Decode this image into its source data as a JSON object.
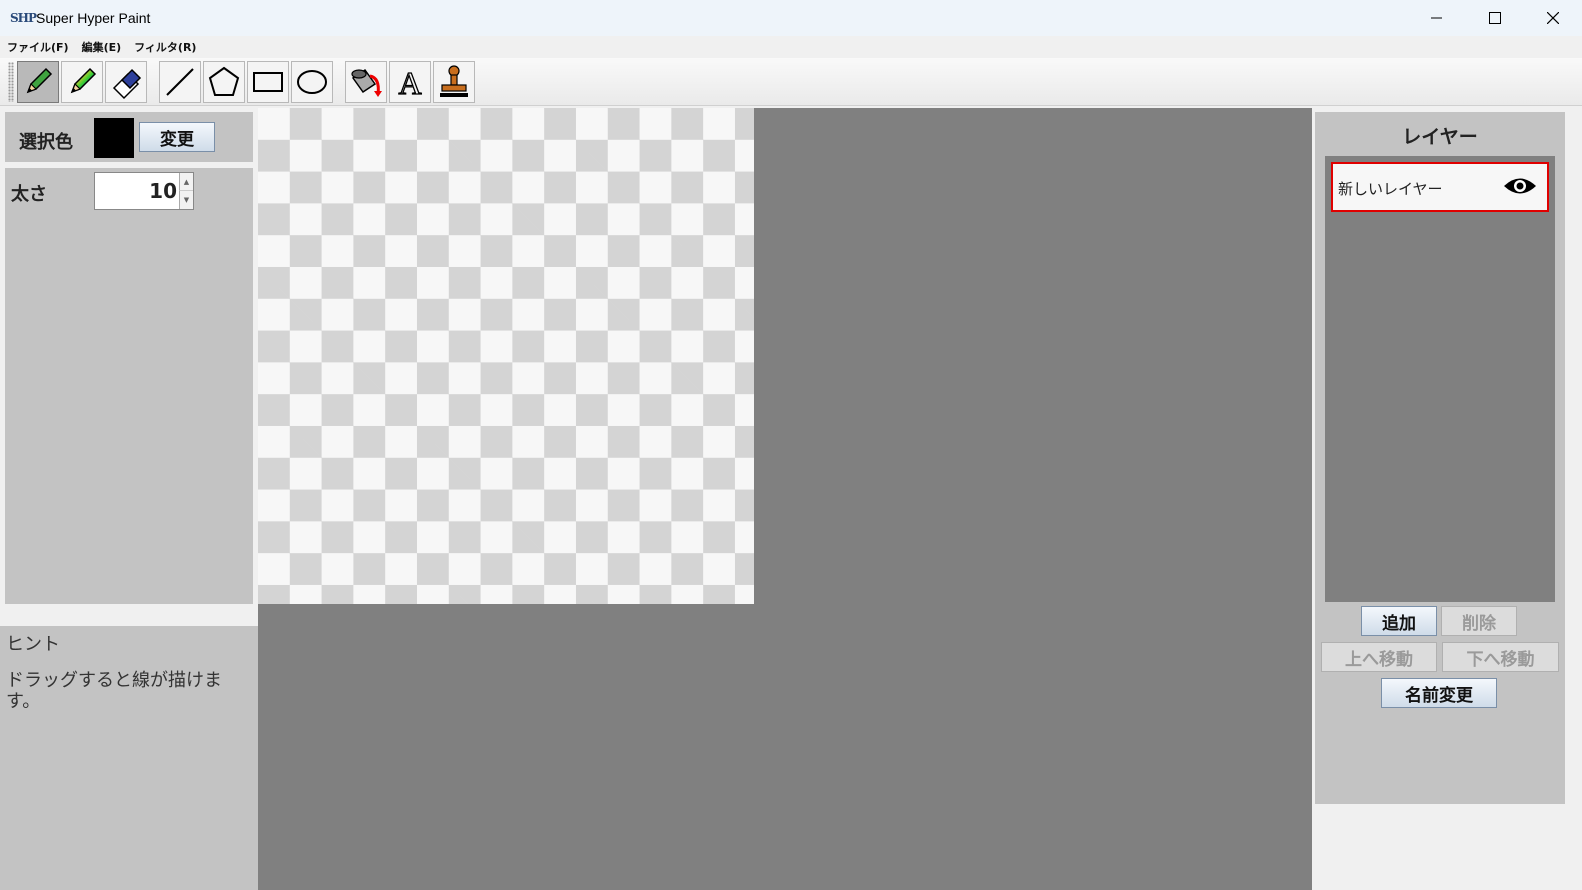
{
  "window": {
    "title": "Super Hyper Paint",
    "icon_text": "SHP"
  },
  "menu": [
    {
      "label": "ファイル(F)"
    },
    {
      "label": "編集(E)"
    },
    {
      "label": "フィルタ(R)"
    }
  ],
  "toolbar": {
    "tools": [
      {
        "name": "pencil",
        "active": true
      },
      {
        "name": "rainbow-pencil"
      },
      {
        "name": "eraser"
      },
      {
        "name": "line"
      },
      {
        "name": "polygon"
      },
      {
        "name": "rectangle"
      },
      {
        "name": "ellipse"
      },
      {
        "name": "fill-bucket"
      },
      {
        "name": "text"
      },
      {
        "name": "stamp"
      }
    ]
  },
  "left": {
    "color_label": "選択色",
    "selected_color": "#000000",
    "change_label": "変更",
    "width_label": "太さ",
    "width_value": "10",
    "hint_title": "ヒント",
    "hint_text": "ドラッグすると線が描けます。"
  },
  "layers": {
    "title": "レイヤー",
    "items": [
      {
        "name": "新しいレイヤー",
        "visible": true,
        "selected": true
      }
    ],
    "add_label": "追加",
    "delete_label": "削除",
    "move_up_label": "上へ移動",
    "move_down_label": "下へ移動",
    "rename_label": "名前変更"
  }
}
